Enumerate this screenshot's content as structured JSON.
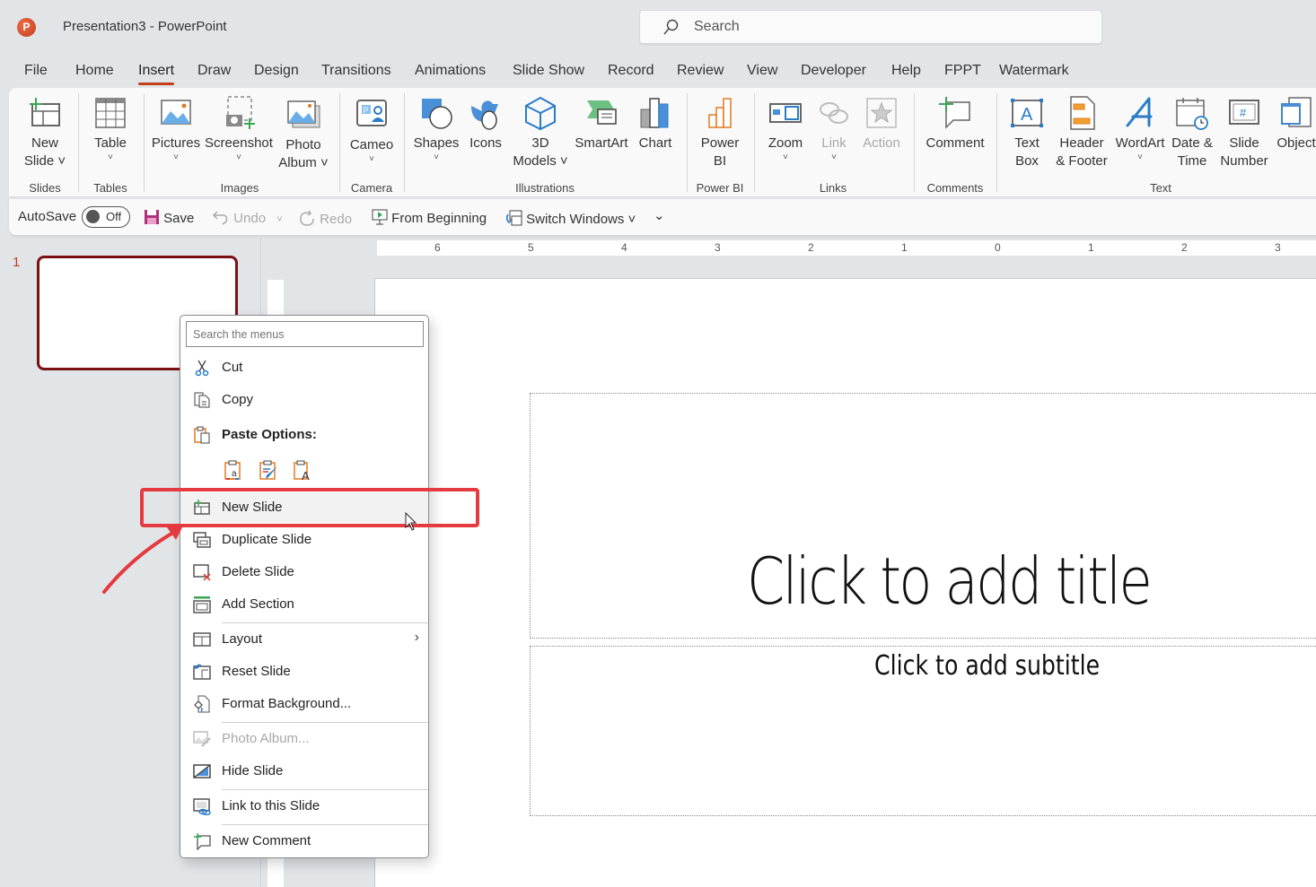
{
  "window": {
    "app_icon_letter": "P",
    "title": "Presentation3  -  PowerPoint",
    "search_placeholder": "Search"
  },
  "tabs": [
    {
      "label": "File"
    },
    {
      "label": "Home"
    },
    {
      "label": "Insert",
      "active": true
    },
    {
      "label": "Draw"
    },
    {
      "label": "Design"
    },
    {
      "label": "Transitions"
    },
    {
      "label": "Animations"
    },
    {
      "label": "Slide Show"
    },
    {
      "label": "Record"
    },
    {
      "label": "Review"
    },
    {
      "label": "View"
    },
    {
      "label": "Developer"
    },
    {
      "label": "Help"
    },
    {
      "label": "FPPT"
    },
    {
      "label": "Watermark"
    }
  ],
  "ribbon": {
    "groups": {
      "slides": "Slides",
      "tables": "Tables",
      "images": "Images",
      "camera": "Camera",
      "illustrations": "Illustrations",
      "powerbi": "Power BI",
      "links": "Links",
      "comments": "Comments",
      "text": "Text"
    },
    "buttons": {
      "new_slide": {
        "line1": "New",
        "line2": "Slide ˅"
      },
      "table": {
        "line1": "Table",
        "line2": "˅"
      },
      "pictures": {
        "line1": "Pictures",
        "line2": "˅"
      },
      "screenshot": {
        "line1": "Screenshot",
        "line2": "˅"
      },
      "photo_album": {
        "line1": "Photo",
        "line2": "Album ˅"
      },
      "cameo": {
        "line1": "Cameo",
        "line2": "˅"
      },
      "shapes": {
        "line1": "Shapes",
        "line2": "˅"
      },
      "icons": {
        "line1": "Icons",
        "line2": ""
      },
      "models_3d": {
        "line1": "3D",
        "line2": "Models ˅"
      },
      "smartart": {
        "line1": "SmartArt",
        "line2": ""
      },
      "chart": {
        "line1": "Chart",
        "line2": ""
      },
      "power_bi": {
        "line1": "Power",
        "line2": "BI"
      },
      "zoom": {
        "line1": "Zoom",
        "line2": "˅"
      },
      "link": {
        "line1": "Link",
        "line2": "˅"
      },
      "action": {
        "line1": "Action",
        "line2": ""
      },
      "comment": {
        "line1": "Comment",
        "line2": ""
      },
      "text_box": {
        "line1": "Text",
        "line2": "Box"
      },
      "header_footer": {
        "line1": "Header",
        "line2": "& Footer"
      },
      "wordart": {
        "line1": "WordArt",
        "line2": "˅"
      },
      "date_time": {
        "line1": "Date &",
        "line2": "Time"
      },
      "slide_number": {
        "line1": "Slide",
        "line2": "Number"
      },
      "object": {
        "line1": "Object",
        "line2": ""
      }
    }
  },
  "quick_access": {
    "autosave_label": "AutoSave",
    "autosave_state": "Off",
    "save": "Save",
    "undo": "Undo",
    "redo": "Redo",
    "from_beginning": "From Beginning",
    "switch_windows": "Switch Windows ˅",
    "customize": "⌄"
  },
  "ruler": {
    "labels": [
      "6",
      "5",
      "4",
      "3",
      "2",
      "1",
      "0",
      "1",
      "2",
      "3"
    ]
  },
  "slide_panel": {
    "slide_number": "1"
  },
  "slide": {
    "title_placeholder": "Click to add title",
    "subtitle_placeholder": "Click to add subtitle"
  },
  "context_menu": {
    "search_placeholder": "Search the menus",
    "items": [
      {
        "label": "Cut",
        "icon": "scissors-icon"
      },
      {
        "label": "Copy",
        "icon": "copy-icon"
      },
      {
        "label": "Paste Options:",
        "icon": "paste-icon",
        "bold": true
      },
      {
        "label": "New Slide",
        "icon": "new-slide-icon",
        "highlighted": true
      },
      {
        "label": "Duplicate Slide",
        "icon": "duplicate-slide-icon"
      },
      {
        "label": "Delete Slide",
        "icon": "delete-slide-icon"
      },
      {
        "label": "Add Section",
        "icon": "add-section-icon"
      },
      {
        "label": "Layout",
        "icon": "layout-icon",
        "submenu": true
      },
      {
        "label": "Reset Slide",
        "icon": "reset-slide-icon"
      },
      {
        "label": "Format Background...",
        "icon": "format-background-icon"
      },
      {
        "label": "Photo Album...",
        "icon": "photo-album-icon",
        "disabled": true
      },
      {
        "label": "Hide Slide",
        "icon": "hide-slide-icon"
      },
      {
        "label": "Link to this Slide",
        "icon": "link-slide-icon"
      },
      {
        "label": "New Comment",
        "icon": "new-comment-icon"
      }
    ],
    "paste_options": [
      "Use Destination Theme",
      "Keep Source Formatting",
      "Keep Text Only"
    ]
  },
  "colors": {
    "accent": "#c43e1c",
    "selected_slide_border": "#7a1013",
    "annotation_red": "#e53a3f",
    "ribbon_blue": "#2a7cc7",
    "green": "#3aa655"
  }
}
